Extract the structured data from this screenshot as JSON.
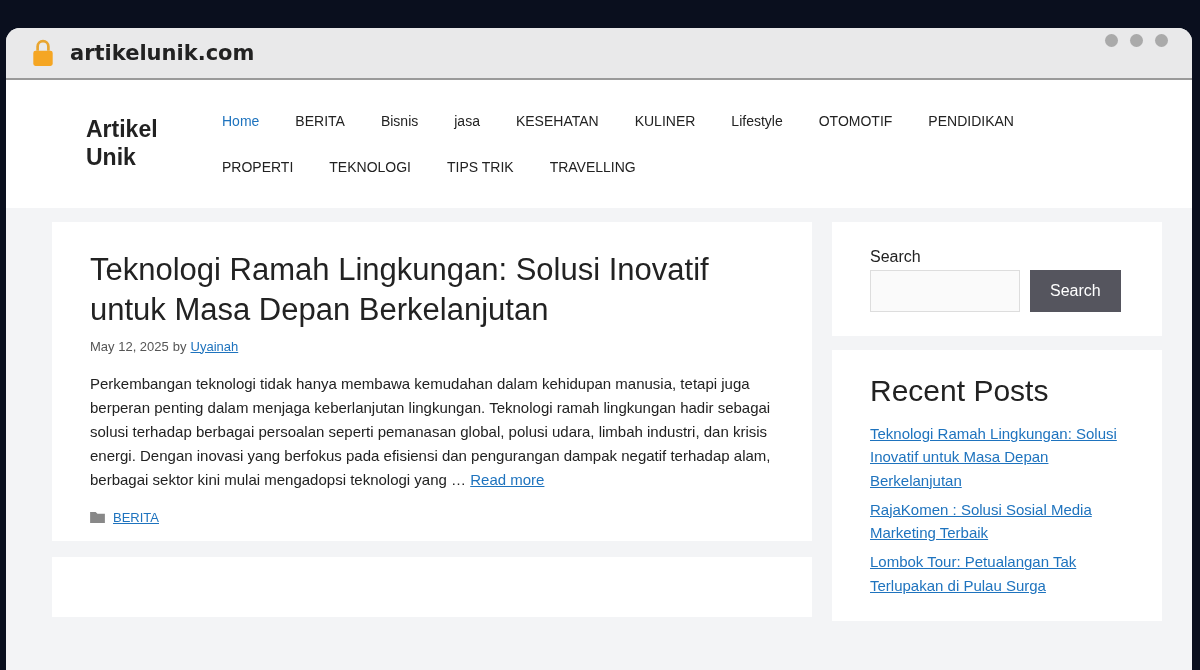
{
  "browser": {
    "address": "artikelunik.com"
  },
  "site": {
    "title": "Artikel Unik"
  },
  "nav": [
    {
      "label": "Home",
      "selected": true
    },
    {
      "label": "BERITA",
      "selected": false
    },
    {
      "label": "Bisnis",
      "selected": false
    },
    {
      "label": "jasa",
      "selected": false
    },
    {
      "label": "KESEHATAN",
      "selected": false
    },
    {
      "label": "KULINER",
      "selected": false
    },
    {
      "label": "Lifestyle",
      "selected": false
    },
    {
      "label": "OTOMOTIF",
      "selected": false
    },
    {
      "label": "PENDIDIKAN",
      "selected": false
    },
    {
      "label": "PROPERTI",
      "selected": false
    },
    {
      "label": "TEKNOLOGI",
      "selected": false
    },
    {
      "label": "TIPS TRIK",
      "selected": false
    },
    {
      "label": "TRAVELLING",
      "selected": false
    }
  ],
  "article": {
    "title": "Teknologi Ramah Lingkungan: Solusi Inovatif untuk Masa Depan Berkelanjutan",
    "date": "May 12, 2025",
    "by": "by",
    "author": "Uyainah",
    "excerpt": "Perkembangan teknologi tidak hanya membawa kemudahan dalam kehidupan manusia, tetapi juga berperan penting dalam menjaga keberlanjutan lingkungan. Teknologi ramah lingkungan hadir sebagai solusi terhadap berbagai persoalan seperti pemanasan global, polusi udara, limbah industri, dan krisis energi. Dengan inovasi yang berfokus pada efisiensi dan pengurangan dampak negatif terhadap alam, berbagai sektor kini mulai mengadopsi teknologi yang …",
    "read_more": "Read more",
    "category": "BERITA"
  },
  "search_widget": {
    "label": "Search",
    "button": "Search"
  },
  "recent_posts": {
    "title": "Recent Posts",
    "items": [
      "Teknologi Ramah Lingkungan: Solusi Inovatif untuk Masa Depan Berkelanjutan",
      "RajaKomen : Solusi Sosial Media Marketing Terbaik",
      "Lombok Tour: Petualangan Tak Terlupakan di Pulau Surga"
    ]
  }
}
